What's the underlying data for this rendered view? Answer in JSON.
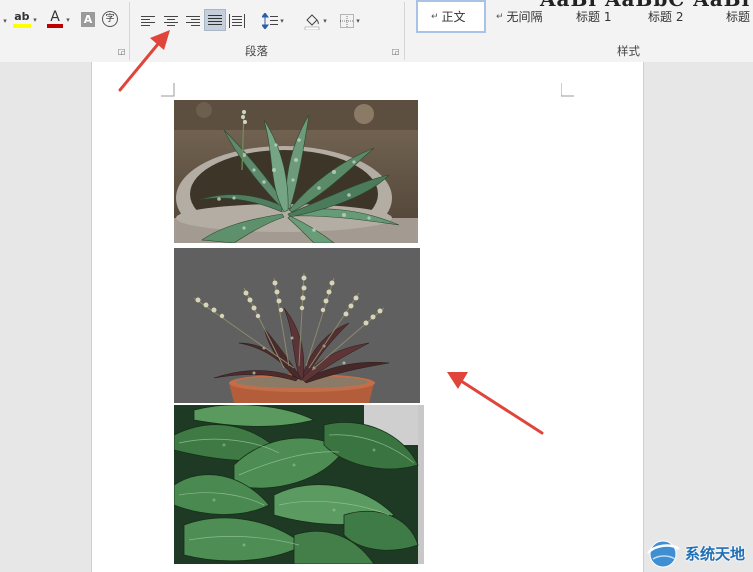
{
  "ribbon": {
    "paragraph_group_label": "段落",
    "styles_group_label": "样式",
    "gallery_top_preview": "AaBl AaBbC AaBl",
    "styles": [
      {
        "mark": "↵",
        "label": "正文"
      },
      {
        "mark": "↵",
        "label": "无间隔"
      },
      {
        "mark": "",
        "label": "标题 1"
      },
      {
        "mark": "",
        "label": "标题 2"
      },
      {
        "mark": "",
        "label": "标题"
      }
    ],
    "font_color": "#c00000",
    "highlight_color": "#ffff00",
    "char_shading_label": "A",
    "char_border_label": "字",
    "font_color_label": "A",
    "highlight_label": "ab"
  },
  "document": {
    "images": [
      {
        "name": "potted-plant-spotted-leaves"
      },
      {
        "name": "plant-with-flower-spikes"
      },
      {
        "name": "green-leaves-closeup"
      }
    ]
  },
  "watermark": {
    "text": "系统天地",
    "brand_color": "#1f6fb5"
  },
  "annotations": {
    "arrow_color": "#e0453b"
  }
}
